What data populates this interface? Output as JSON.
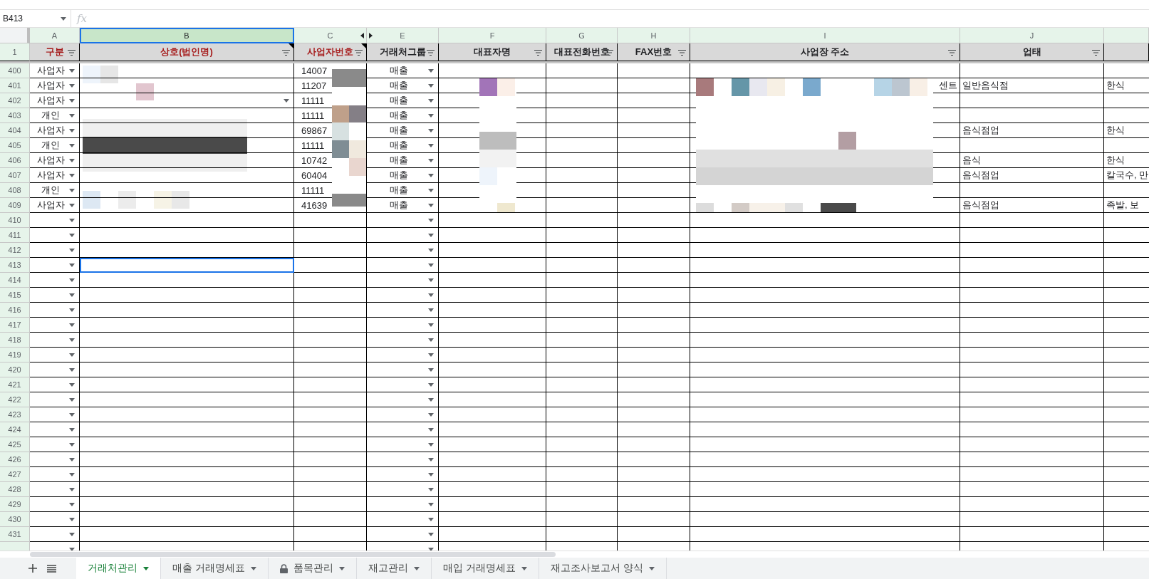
{
  "name_box": "B413",
  "formula_label": "fx",
  "column_letters": [
    {
      "letter": "A",
      "selected": false,
      "kind": "plain"
    },
    {
      "letter": "B",
      "selected": true,
      "kind": "plain"
    },
    {
      "letter": "C",
      "selected": false,
      "kind": "before-hidden"
    },
    {
      "letter": "E",
      "selected": false,
      "kind": "after-hidden"
    },
    {
      "letter": "F",
      "selected": false,
      "kind": "plain"
    },
    {
      "letter": "G",
      "selected": false,
      "kind": "plain"
    },
    {
      "letter": "H",
      "selected": false,
      "kind": "plain"
    },
    {
      "letter": "I",
      "selected": false,
      "kind": "plain"
    },
    {
      "letter": "J",
      "selected": false,
      "kind": "plain"
    }
  ],
  "header_row": {
    "number": "1",
    "cells": [
      {
        "text": "구분",
        "color": "#a61c1c",
        "note": false
      },
      {
        "text": "상호(법인명)",
        "color": "#a61c1c",
        "note": true
      },
      {
        "text": "사업자번호",
        "color": "#a61c1c",
        "note": true
      },
      {
        "text": "거래처그룹",
        "color": "#202124",
        "note": false
      },
      {
        "text": "대표자명",
        "color": "#202124",
        "note": false
      },
      {
        "text": "대표전화번호",
        "color": "#202124",
        "note": false
      },
      {
        "text": "FAX번호",
        "color": "#202124",
        "note": false
      },
      {
        "text": "사업장 주소",
        "color": "#202124",
        "note": false
      },
      {
        "text": "업태",
        "color": "#202124",
        "note": false
      }
    ]
  },
  "rows": [
    {
      "number": "400",
      "type": "사업자",
      "business_no": "14007",
      "group": "매출",
      "name_dropdown": false
    },
    {
      "number": "401",
      "type": "사업자",
      "business_no": "11207",
      "group": "매출",
      "address_end": "센트",
      "industry": "일반음식점",
      "column_k": "한식",
      "name_dropdown": false
    },
    {
      "number": "402",
      "type": "사업자",
      "business_no": "11111",
      "group": "매출",
      "name_dropdown": true
    },
    {
      "number": "403",
      "type": "개인",
      "business_no": "11111",
      "group": "매출",
      "name_dropdown": false
    },
    {
      "number": "404",
      "type": "사업자",
      "business_no": "69867",
      "group": "매출",
      "industry": "음식점업",
      "column_k": "한식",
      "name_dropdown": false
    },
    {
      "number": "405",
      "type": "개인",
      "business_no": "11111",
      "group": "매출",
      "name_dropdown": false
    },
    {
      "number": "406",
      "type": "사업자",
      "business_no": "10742",
      "group": "매출",
      "industry": "음식",
      "column_k": "한식",
      "name_dropdown": false
    },
    {
      "number": "407",
      "type": "사업자",
      "business_no": "60404",
      "group": "매출",
      "industry": "음식점업",
      "column_k": "칼국수, 만",
      "name_dropdown": false
    },
    {
      "number": "408",
      "type": "개인",
      "business_no": "11111",
      "group": "매출",
      "name_dropdown": false
    },
    {
      "number": "409",
      "type": "사업자",
      "business_no": "41639",
      "group": "매출",
      "industry": "음식점업",
      "column_k": "족발, 보",
      "name_dropdown": false
    }
  ],
  "empty_rows": [
    {
      "number": "410",
      "selected": false
    },
    {
      "number": "411",
      "selected": false
    },
    {
      "number": "412",
      "selected": false
    },
    {
      "number": "413",
      "selected": true
    },
    {
      "number": "414",
      "selected": false
    },
    {
      "number": "415",
      "selected": false
    },
    {
      "number": "416",
      "selected": false
    },
    {
      "number": "417",
      "selected": false
    },
    {
      "number": "418",
      "selected": false
    },
    {
      "number": "419",
      "selected": false
    },
    {
      "number": "420",
      "selected": false
    },
    {
      "number": "421",
      "selected": false
    },
    {
      "number": "422",
      "selected": false
    },
    {
      "number": "423",
      "selected": false
    },
    {
      "number": "424",
      "selected": false
    },
    {
      "number": "425",
      "selected": false
    },
    {
      "number": "426",
      "selected": false
    },
    {
      "number": "427",
      "selected": false
    },
    {
      "number": "428",
      "selected": false
    },
    {
      "number": "429",
      "selected": false
    },
    {
      "number": "430",
      "selected": false
    },
    {
      "number": "431",
      "selected": false
    }
  ],
  "sheet_tabs": [
    {
      "label": "거래처관리",
      "selected": true,
      "locked": false
    },
    {
      "label": "매출 거래명세표",
      "selected": false,
      "locked": false
    },
    {
      "label": "품목관리",
      "selected": false,
      "locked": true
    },
    {
      "label": "재고관리",
      "selected": false,
      "locked": false
    },
    {
      "label": "매입 거래명세표",
      "selected": false,
      "locked": false
    },
    {
      "label": "재고조사보고서 양식",
      "selected": false,
      "locked": false
    }
  ]
}
